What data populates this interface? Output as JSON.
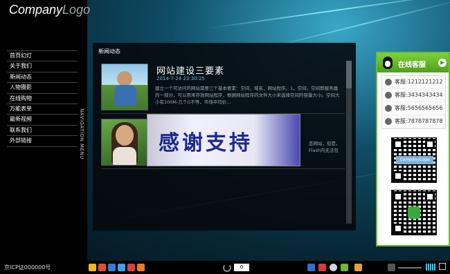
{
  "logo": {
    "part1": "Company",
    "part2": "Logo"
  },
  "nav": {
    "items": [
      "首页幻灯",
      "关于我们",
      "新闻动态",
      "人物摄影",
      "在线购物",
      "万能表单",
      "最新视频",
      "联系我们",
      "外部链接"
    ],
    "vertical_label": "NAVIGATION MENU"
  },
  "panel": {
    "title": "新闻动态",
    "articles": [
      {
        "title": "网站建设三要素",
        "date": "2014-7-24 23:30:25",
        "summary": "建立一个可访问的网站需要三个基本要素：空间，域名，网站程序。1，空间。空间即服务器的一部分，可以用来存放网站程序，根据网站程序的文件大小来选择空间的容量大小。空间大小有100M-几个G不等，市场平均价..."
      },
      {
        "title": "",
        "date": "",
        "summary": "态网站，但是，Flash内无法包"
      }
    ]
  },
  "popup": {
    "text": "感谢支持"
  },
  "service": {
    "title": "在线客服",
    "items": [
      "客服:1212121212",
      "客服:3434343434",
      "客服:5656565656",
      "客服:7878787878"
    ],
    "qr_logo": "CompanyLogo"
  },
  "footer": {
    "icp": "京ICP证000000号"
  },
  "taskbar": {
    "counter": "0"
  },
  "colors": {
    "accent": "#6bbf2a",
    "date": "#6ab8e0",
    "popup_text": "#1d2a8a"
  }
}
